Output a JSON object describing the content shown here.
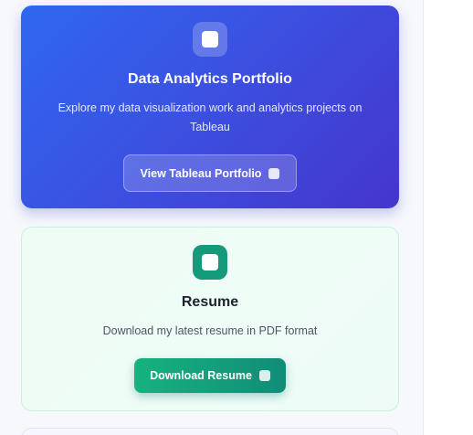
{
  "portfolio": {
    "title": "Data Analytics Portfolio",
    "description": "Explore my data visualization work and analytics projects on Tableau",
    "button_label": "View Tableau Portfolio",
    "icon": "chart-icon",
    "accent": "#3c4fe0"
  },
  "resume": {
    "title": "Resume",
    "description": "Download my latest resume in PDF format",
    "button_label": "Download Resume",
    "icon": "document-icon",
    "accent": "#14997a"
  }
}
